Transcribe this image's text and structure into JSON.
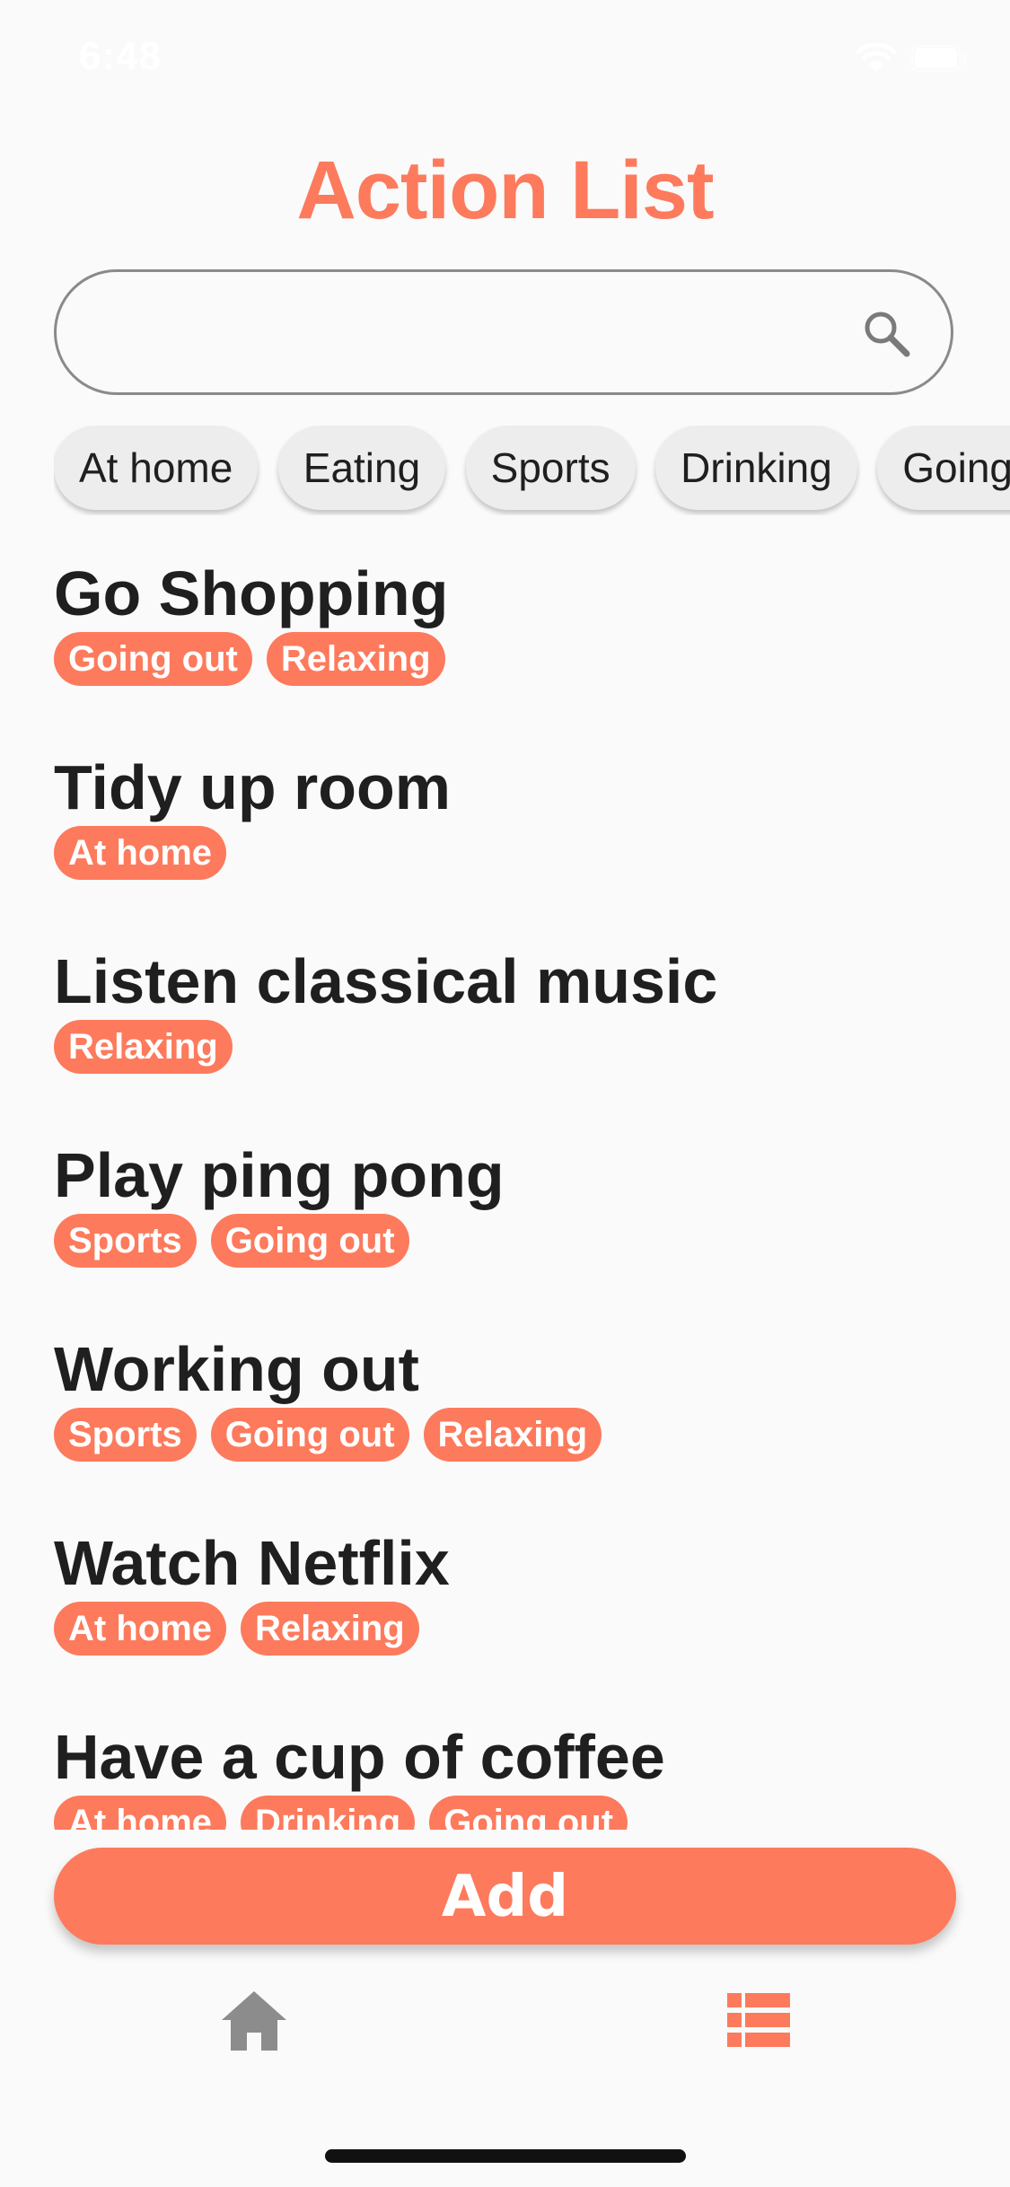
{
  "status_bar": {
    "time": "6:48",
    "icons": [
      "wifi-icon",
      "battery-icon"
    ]
  },
  "header": {
    "title": "Action List"
  },
  "search": {
    "value": "",
    "placeholder": "",
    "icon": "search-icon"
  },
  "filters": [
    {
      "label": "At home"
    },
    {
      "label": "Eating"
    },
    {
      "label": "Sports"
    },
    {
      "label": "Drinking"
    },
    {
      "label": "Going out"
    }
  ],
  "actions": [
    {
      "title": "Go Shopping",
      "tags": [
        "Going out",
        "Relaxing"
      ]
    },
    {
      "title": "Tidy up room",
      "tags": [
        "At home"
      ]
    },
    {
      "title": "Listen classical music",
      "tags": [
        "Relaxing"
      ]
    },
    {
      "title": "Play ping pong",
      "tags": [
        "Sports",
        "Going out"
      ]
    },
    {
      "title": "Working out",
      "tags": [
        "Sports",
        "Going out",
        "Relaxing"
      ]
    },
    {
      "title": "Watch Netflix",
      "tags": [
        "At home",
        "Relaxing"
      ]
    },
    {
      "title": "Have a cup of coffee",
      "tags": [
        "At home",
        "Drinking",
        "Going out"
      ]
    }
  ],
  "add_button": {
    "label": "Add"
  },
  "bottom_nav": {
    "items": [
      {
        "icon": "home-icon",
        "active": false
      },
      {
        "icon": "list-icon",
        "active": true
      }
    ]
  },
  "colors": {
    "accent": "#fd7a5c",
    "text": "#1f1f1f",
    "background": "#fafafa",
    "chip_background": "#ededed",
    "inactive_icon": "#8c8c8c"
  }
}
